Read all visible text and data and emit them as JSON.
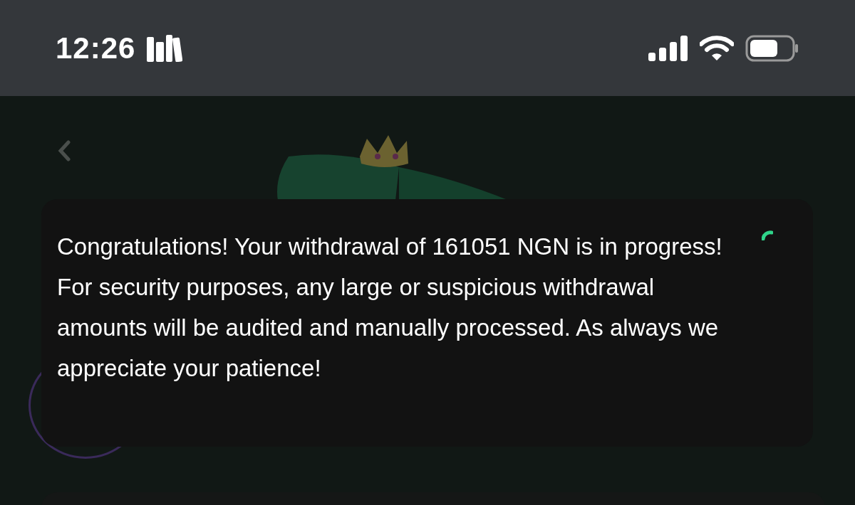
{
  "status_bar": {
    "time": "12:26"
  },
  "toast": {
    "message": "Congratulations! Your withdrawal of 161051 NGN is in progress! For security purposes, any large or suspicious withdrawal amounts will be audited and manually processed. As always we appreciate your patience!"
  }
}
